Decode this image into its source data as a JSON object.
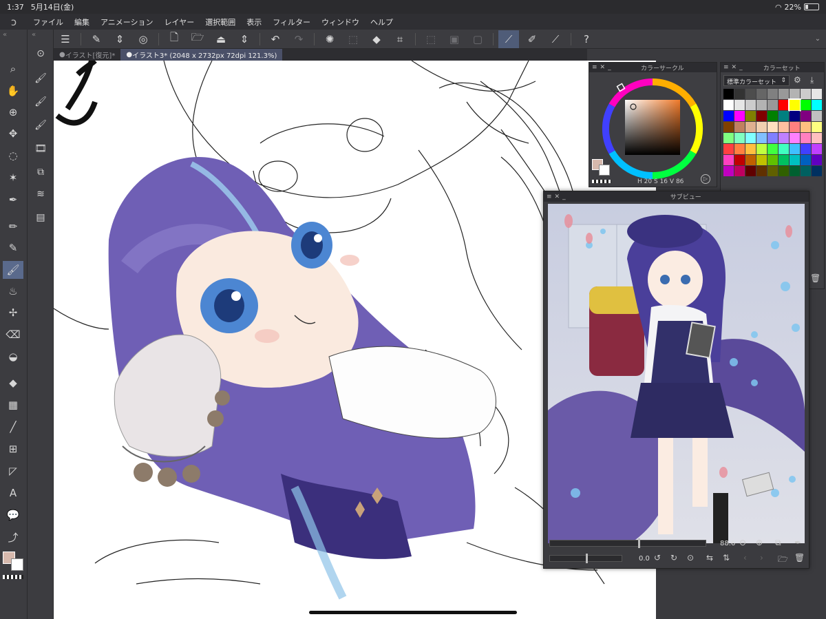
{
  "status": {
    "time": "1:37",
    "date": "5月14日(金)",
    "battery": "22%"
  },
  "menu": [
    "ファイル",
    "編集",
    "アニメーション",
    "レイヤー",
    "選択範囲",
    "表示",
    "フィルター",
    "ウィンドウ",
    "ヘルプ"
  ],
  "tabs": [
    {
      "label": "イラスト[復元]*",
      "active": false
    },
    {
      "label": "イラスト3* (2048 x 2732px 72dpi 121.3%)",
      "active": true
    }
  ],
  "color_circle": {
    "title": "カラーサークル",
    "h_label": "H",
    "h": "20",
    "s_label": "S",
    "s": "16",
    "v_label": "V",
    "v": "86"
  },
  "color_set": {
    "title": "カラーセット",
    "dropdown": "標準カラーセット",
    "colors": [
      "#000000",
      "#333333",
      "#4d4d4d",
      "#666666",
      "#808080",
      "#999999",
      "#b3b3b3",
      "#cccccc",
      "#e6e6e6",
      "#ffffff",
      "#e6e6e6",
      "#cccccc",
      "#b3b3b3",
      "#999999",
      "#ff0000",
      "#ffff00",
      "#00ff00",
      "#00ffff",
      "#0000ff",
      "#ff00ff",
      "#808000",
      "#800000",
      "#008000",
      "#008080",
      "#000080",
      "#800080",
      "#c0c0c0",
      "#804000",
      "#c08060",
      "#e0b090",
      "#f0d0b0",
      "#ffe0c0",
      "#ffc0a0",
      "#ff8080",
      "#ffc080",
      "#ffff80",
      "#80ff80",
      "#80ffc0",
      "#80ffff",
      "#80c0ff",
      "#8080ff",
      "#c080ff",
      "#ff80ff",
      "#ff80c0",
      "#ffc0c0",
      "#ff4040",
      "#ff8040",
      "#ffc040",
      "#c0ff40",
      "#40ff40",
      "#40ffc0",
      "#40c0ff",
      "#4040ff",
      "#c040ff",
      "#ff40c0",
      "#c00000",
      "#c06000",
      "#c0c000",
      "#60c000",
      "#00c060",
      "#00c0c0",
      "#0060c0",
      "#6000c0",
      "#c000c0",
      "#c00060",
      "#600000",
      "#603000",
      "#606000",
      "#306000",
      "#006030",
      "#006060",
      "#003060"
    ]
  },
  "subview": {
    "title": "サブビュー",
    "zoom": "88.6",
    "rotate": "0.0"
  }
}
